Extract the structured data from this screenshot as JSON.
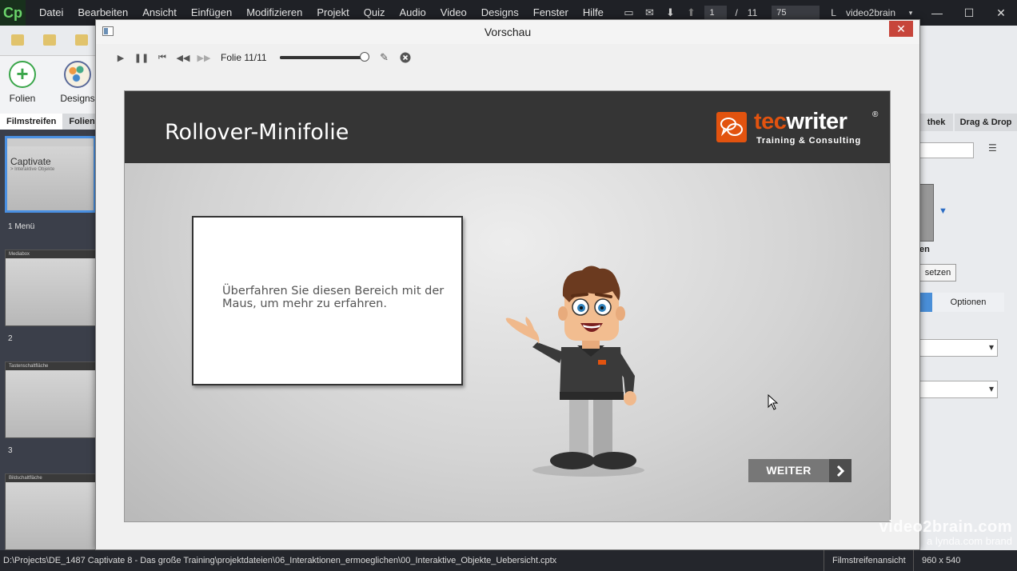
{
  "app": {
    "logo": "Cp",
    "menu": [
      "Datei",
      "Bearbeiten",
      "Ansicht",
      "Einfügen",
      "Modifizieren",
      "Projekt",
      "Quiz",
      "Audio",
      "Video",
      "Designs",
      "Fenster",
      "Hilfe"
    ],
    "slide_current": "1",
    "slide_separator": "/",
    "slide_total": "11",
    "zoom": "75",
    "layout": "L",
    "user": "video2brain"
  },
  "left_panel": {
    "tools": [
      "Folien",
      "Designs"
    ],
    "tabs": [
      "Filmstreifen",
      "Folien"
    ],
    "thumbs": [
      {
        "title": "Captivate",
        "subtitle": "> Interaktive Objekte",
        "label": "1 Menü"
      },
      {
        "bar": "Mediabox",
        "label": "2"
      },
      {
        "bar": "Tastenschaltfläche",
        "label": "3"
      },
      {
        "bar": "Bildschaltfläche",
        "label": ""
      }
    ]
  },
  "right_panel": {
    "tabs": [
      "thek",
      "Drag & Drop"
    ],
    "text_en": "en",
    "btn_setzen": "setzen",
    "tab_optionen": "Optionen"
  },
  "preview": {
    "title": "Vorschau",
    "close_symbol": "✕",
    "slide_counter": "Folie 11/11",
    "progress": 1.0
  },
  "slide": {
    "title": "Rollover-Minifolie",
    "logo": {
      "name_part1": "tec",
      "name_part2": "writer",
      "reg": "®",
      "sub": "Training & Consulting"
    },
    "rollover_text": "Überfahren Sie diesen Bereich mit der Maus, um mehr zu erfahren.",
    "next_button": "WEITER"
  },
  "status": {
    "path": "D:\\Projects\\DE_1487 Captivate 8 - Das große Training\\projektdateien\\06_Interaktionen_ermoeglichen\\00_Interaktive_Objekte_Uebersicht.cptx",
    "view": "Filmstreifenansicht",
    "size": "960 x 540"
  },
  "watermark": {
    "line1": "video2brain.com",
    "line2": "a lynda.com brand"
  },
  "colors": {
    "accent_orange": "#e2530f",
    "header_dark": "#353535",
    "close_red": "#c7453a"
  }
}
